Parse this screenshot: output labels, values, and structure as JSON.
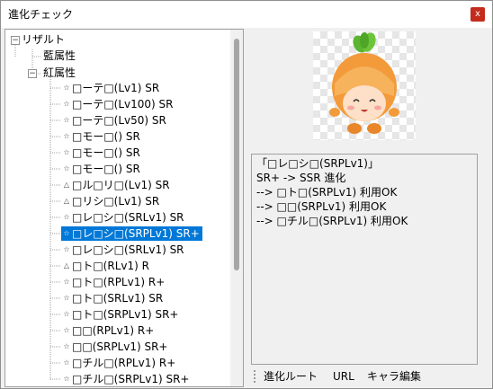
{
  "window": {
    "title": "進化チェック",
    "close_glyph": "x"
  },
  "tree": {
    "root": {
      "label": "リザルト",
      "expander": "−"
    },
    "groups": [
      {
        "label": "藍属性"
      },
      {
        "label": "紅属性",
        "expander": "−"
      }
    ],
    "items": [
      {
        "mark": "☆",
        "label": "□ーテ□(Lv1) SR"
      },
      {
        "mark": "☆",
        "label": "□ーテ□(Lv100) SR"
      },
      {
        "mark": "☆",
        "label": "□ーテ□(Lv50) SR"
      },
      {
        "mark": "☆",
        "label": "□モー□() SR"
      },
      {
        "mark": "☆",
        "label": "□モー□() SR"
      },
      {
        "mark": "☆",
        "label": "□モー□() SR"
      },
      {
        "mark": "△",
        "label": "□ル□リ□(Lv1) SR"
      },
      {
        "mark": "△",
        "label": "□リシ□(Lv1) SR"
      },
      {
        "mark": "☆",
        "label": "□レ□シ□(SRLv1) SR"
      },
      {
        "mark": "☆",
        "label": "□レ□シ□(SRPLv1) SR+",
        "selected": true
      },
      {
        "mark": "☆",
        "label": "□レ□シ□(SRLv1) SR"
      },
      {
        "mark": "△",
        "label": "□ト□(RLv1) R"
      },
      {
        "mark": "☆",
        "label": "□ト□(RPLv1) R+"
      },
      {
        "mark": "☆",
        "label": "□ト□(SRLv1) SR"
      },
      {
        "mark": "☆",
        "label": "□ト□(SRPLv1) SR+"
      },
      {
        "mark": "☆",
        "label": "□□(RPLv1) R+"
      },
      {
        "mark": "☆",
        "label": "□□(SRPLv1) SR+"
      },
      {
        "mark": "☆",
        "label": "□チル□(RPLv1) R+"
      },
      {
        "mark": "☆",
        "label": "□チル□(SRPLv1) SR+"
      }
    ]
  },
  "info": {
    "lines": [
      "「□レ□シ□(SRPLv1)」",
      "SR+ -> SSR 進化",
      "--> □ト□(SRPLv1) 利用OK",
      "--> □□(SRPLv1) 利用OK",
      "--> □チル□(SRPLv1) 利用OK"
    ]
  },
  "menu": {
    "route_label": "進化ルート",
    "url_label": "URL",
    "chara_edit_label": "キャラ編集"
  },
  "preview": {
    "icon": "carrot-mascot-icon"
  },
  "colors": {
    "selection": "#0078d7",
    "close": "#c42b1c",
    "mascot_orange": "#f39a3a",
    "mascot_green": "#5cb531"
  }
}
